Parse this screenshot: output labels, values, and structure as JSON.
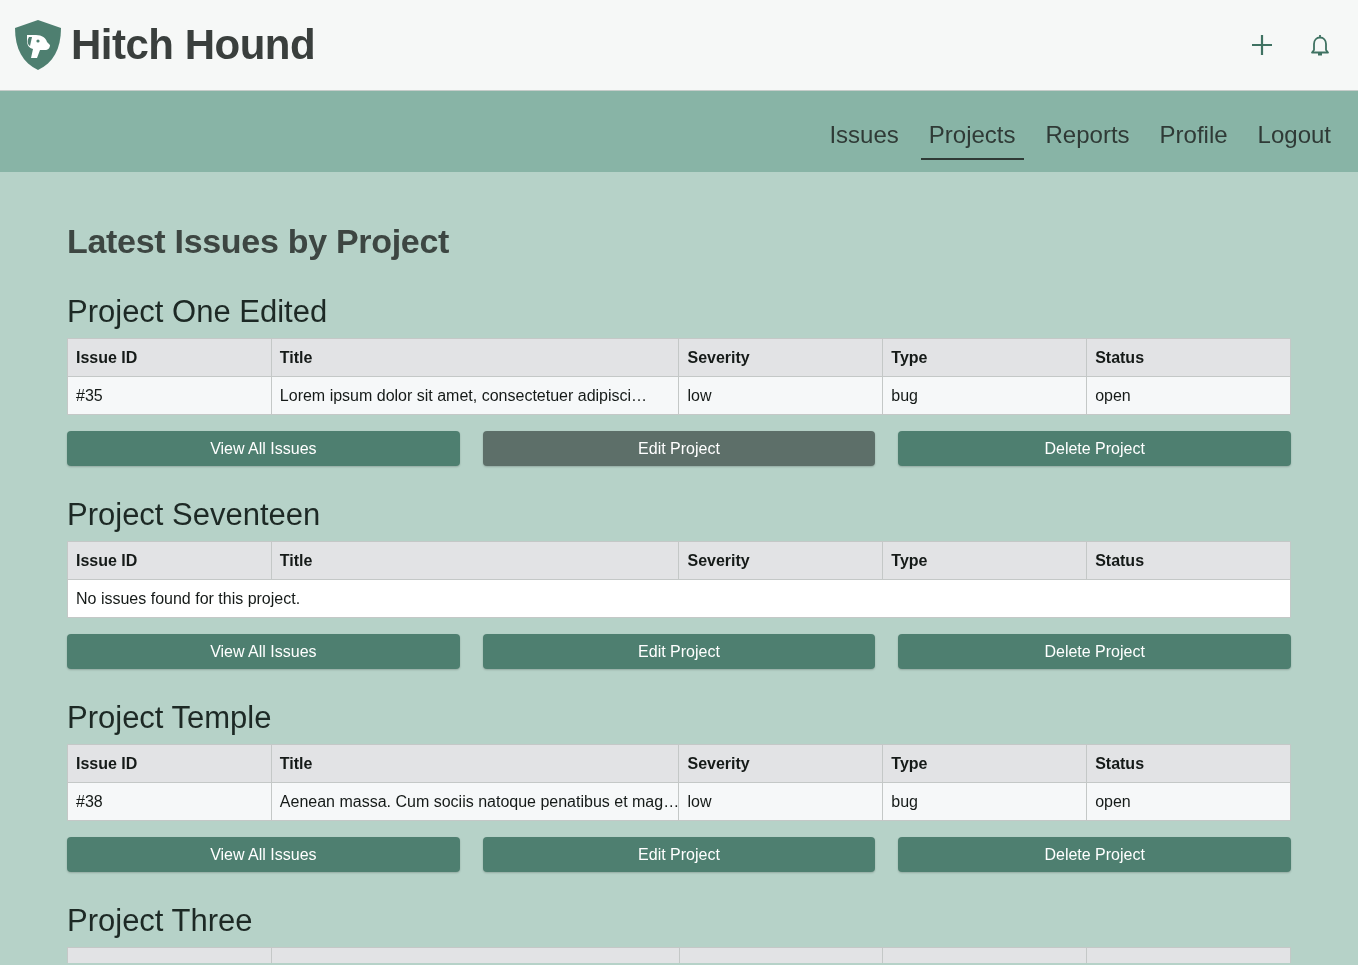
{
  "app": {
    "title": "Hitch Hound"
  },
  "nav": [
    {
      "label": "Issues",
      "selected": false
    },
    {
      "label": "Projects",
      "selected": true
    },
    {
      "label": "Reports",
      "selected": false
    },
    {
      "label": "Profile",
      "selected": false
    },
    {
      "label": "Logout",
      "selected": false
    }
  ],
  "page_title": "Latest Issues by Project",
  "projects": [
    {
      "name": "Project One Edited",
      "columns": [
        "Issue ID",
        "Title",
        "Severity",
        "Type",
        "Status"
      ],
      "rows": [
        {
          "cells": [
            "#35",
            "Lorem ipsum dolor sit amet, consectetuer adipisci…",
            "low",
            "bug",
            "open"
          ]
        }
      ],
      "buttons": [
        {
          "label": "View All Issues",
          "hovered": false
        },
        {
          "label": "Edit Project",
          "hovered": true
        },
        {
          "label": "Delete Project",
          "hovered": false
        }
      ]
    },
    {
      "name": "Project Seventeen",
      "columns": [
        "Issue ID",
        "Title",
        "Severity",
        "Type",
        "Status"
      ],
      "empty_message": "No issues found for this project.",
      "buttons": [
        {
          "label": "View All Issues",
          "hovered": false
        },
        {
          "label": "Edit Project",
          "hovered": false
        },
        {
          "label": "Delete Project",
          "hovered": false
        }
      ]
    },
    {
      "name": "Project Temple",
      "columns": [
        "Issue ID",
        "Title",
        "Severity",
        "Type",
        "Status"
      ],
      "rows": [
        {
          "cells": [
            "#38",
            "Aenean massa. Cum sociis natoque penatibus et mag…",
            "low",
            "bug",
            "open"
          ]
        }
      ],
      "buttons": [
        {
          "label": "View All Issues",
          "hovered": false
        },
        {
          "label": "Edit Project",
          "hovered": false
        },
        {
          "label": "Delete Project",
          "hovered": false
        }
      ]
    },
    {
      "name": "Project Three",
      "table_cut_off": true
    }
  ]
}
